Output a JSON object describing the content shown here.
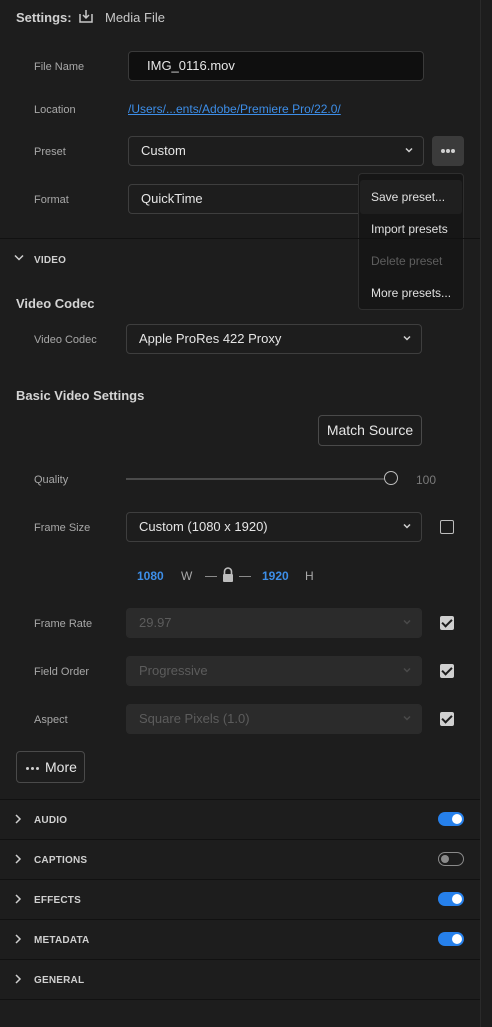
{
  "header": {
    "title": "Settings:",
    "media_label": "Media File",
    "icon": "download-to-tray-icon"
  },
  "file": {
    "name_label": "File Name",
    "name_value": "IMG_0116.mov",
    "location_label": "Location",
    "location_value": "/Users/...ents/Adobe/Premiere Pro/22.0/",
    "preset_label": "Preset",
    "preset_value": "Custom",
    "format_label": "Format",
    "format_value": "QuickTime"
  },
  "preset_menu": {
    "items": [
      {
        "label": "Save preset...",
        "enabled": true
      },
      {
        "label": "Import presets",
        "enabled": true
      },
      {
        "label": "Delete preset",
        "enabled": false
      },
      {
        "label": "More presets...",
        "enabled": true
      }
    ]
  },
  "video": {
    "section_label": "VIDEO",
    "codec_header": "Video Codec",
    "codec_label": "Video Codec",
    "codec_value": "Apple ProRes 422 Proxy",
    "basic_header": "Basic Video Settings",
    "match_source": "Match Source",
    "quality_label": "Quality",
    "quality_value": "100",
    "quality_level": 1.0,
    "frame_size_label": "Frame Size",
    "frame_size_value": "Custom (1080 x 1920)",
    "frame_size_checked": false,
    "width_value": "1080",
    "width_unit": "W",
    "height_value": "1920",
    "height_unit": "H",
    "frame_rate_label": "Frame Rate",
    "frame_rate_value": "29.97",
    "frame_rate_checked": true,
    "field_order_label": "Field Order",
    "field_order_value": "Progressive",
    "field_order_checked": true,
    "aspect_label": "Aspect",
    "aspect_value": "Square Pixels (1.0)",
    "aspect_checked": true,
    "more_label": "More"
  },
  "sections": [
    {
      "label": "AUDIO",
      "enabled": true
    },
    {
      "label": "CAPTIONS",
      "enabled": false
    },
    {
      "label": "EFFECTS",
      "enabled": true
    },
    {
      "label": "METADATA",
      "enabled": true
    },
    {
      "label": "GENERAL"
    }
  ],
  "colors": {
    "accent": "#2680eb",
    "link": "#3d8ee8",
    "background": "#1d1d1d"
  }
}
